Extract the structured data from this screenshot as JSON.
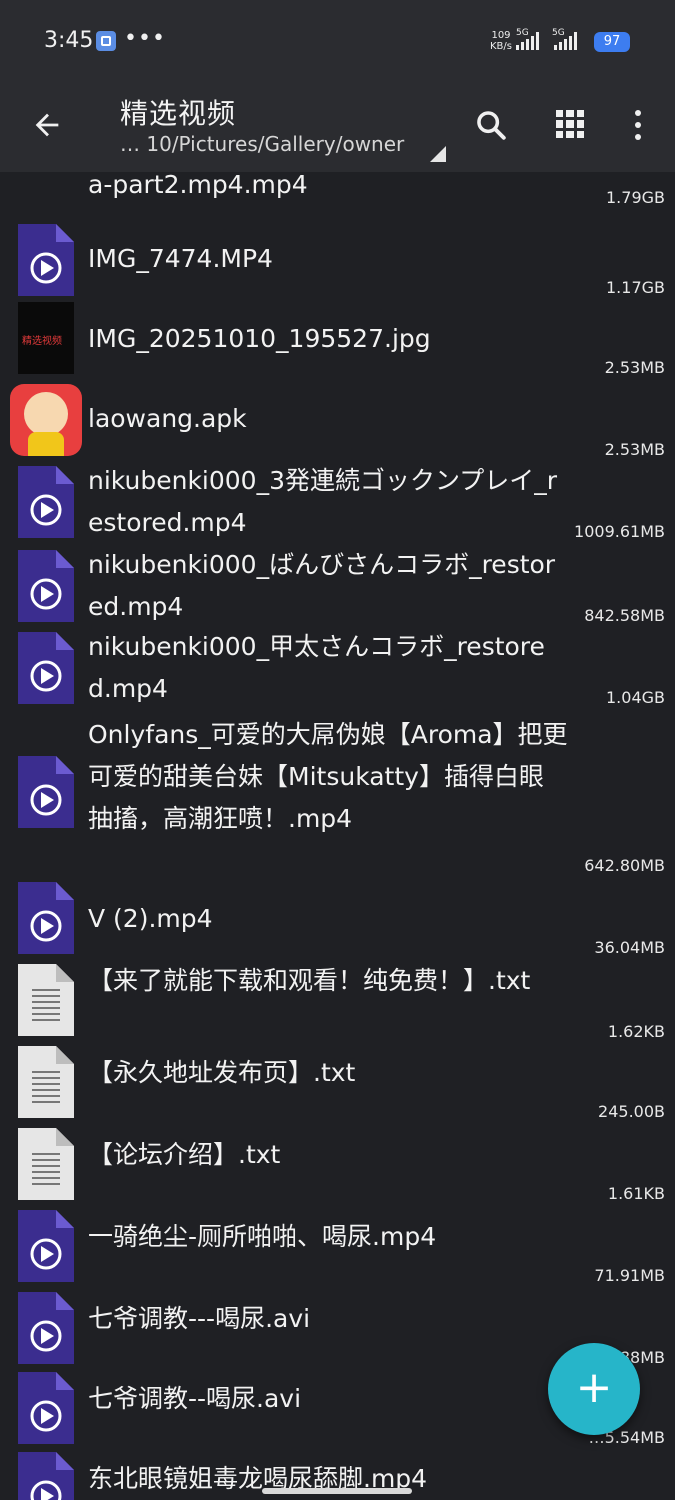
{
  "status_bar": {
    "time": "3:45",
    "more": "•••",
    "net_speed_value": "109",
    "net_speed_unit": "KB/s",
    "sim1_label": "5G",
    "sim2_label": "5G",
    "battery": "97"
  },
  "toolbar": {
    "title": "精选视频",
    "path": "… 10/Pictures/Gallery/owner"
  },
  "files": [
    {
      "name": "a-part2.mp4.mp4",
      "size": "1.79GB",
      "type": "video"
    },
    {
      "name": "IMG_7474.MP4",
      "size": "1.17GB",
      "type": "video"
    },
    {
      "name": "IMG_20251010_195527.jpg",
      "size": "2.53MB",
      "type": "image",
      "thumb_text": "精选视频"
    },
    {
      "name": "laowang.apk",
      "size": "2.53MB",
      "type": "apk"
    },
    {
      "name": "nikubenki000_3発連続ゴックンプレイ_restored.mp4",
      "size": "1009.61MB",
      "type": "video"
    },
    {
      "name": "nikubenki000_ばんびさんコラボ_restored.mp4",
      "size": "842.58MB",
      "type": "video"
    },
    {
      "name": "nikubenki000_甲太さんコラボ_restored.mp4",
      "size": "1.04GB",
      "type": "video"
    },
    {
      "name": "Onlyfans_可爱的大屌伪娘【Aroma】把更可爱的甜美台妹【Mitsukatty】插得白眼抽搐，高潮狂喷！.mp4",
      "size": "642.80MB",
      "type": "video"
    },
    {
      "name": "V (2).mp4",
      "size": "36.04MB",
      "type": "video"
    },
    {
      "name": "【来了就能下载和观看！纯免费！】.txt",
      "size": "1.62KB",
      "type": "text"
    },
    {
      "name": "【永久地址发布页】.txt",
      "size": "245.00B",
      "type": "text"
    },
    {
      "name": "【论坛介绍】.txt",
      "size": "1.61KB",
      "type": "text"
    },
    {
      "name": "一骑绝尘-厕所啪啪、喝尿.mp4",
      "size": "71.91MB",
      "type": "video"
    },
    {
      "name": "七爷调教---喝尿.avi",
      "size": "…88MB",
      "type": "video"
    },
    {
      "name": "七爷调教--喝尿.avi",
      "size": "…5.54MB",
      "type": "video"
    },
    {
      "name": "东北眼镜姐毒龙喝尿舔脚.mp4",
      "size": "",
      "type": "video"
    }
  ],
  "fab": {
    "label": "+"
  },
  "colors": {
    "accent": "#26b5c9",
    "video_icon": "#3b2d8f",
    "background": "#1f2024",
    "toolbar": "#2b2c30"
  }
}
